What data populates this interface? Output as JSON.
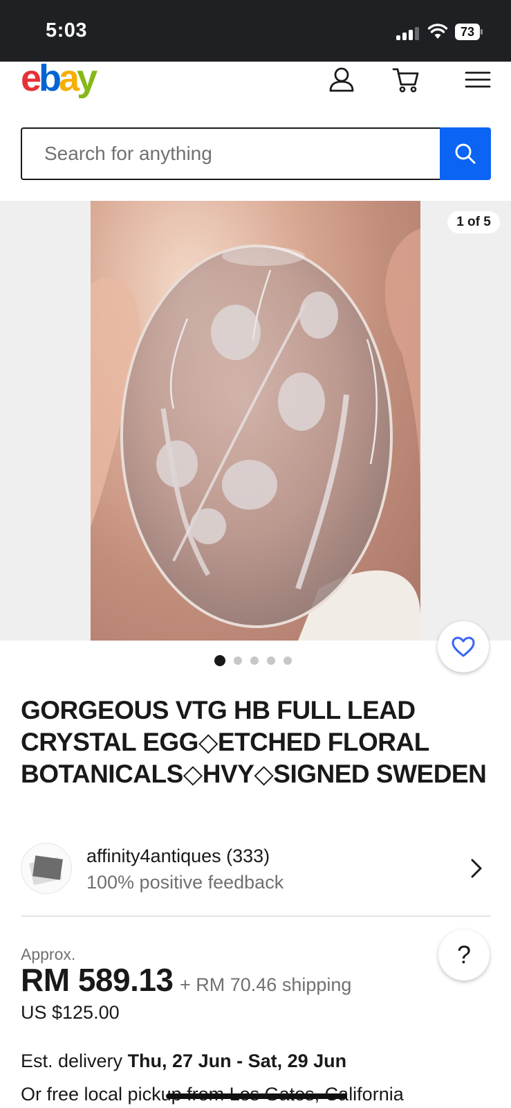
{
  "status_bar": {
    "time": "5:03",
    "battery": "73",
    "icons": [
      "cellular-signal-icon",
      "wifi-icon",
      "battery-icon"
    ]
  },
  "header": {
    "logo": {
      "e": "e",
      "b": "b",
      "a": "a",
      "y": "y"
    },
    "icons": [
      "account-icon",
      "cart-icon",
      "menu-icon"
    ]
  },
  "search": {
    "placeholder": "Search for anything",
    "icon": "search-icon"
  },
  "gallery": {
    "counter": "1 of 5",
    "total_images": 5,
    "active_index": 0,
    "watch_icon": "heart-icon"
  },
  "item": {
    "title": "GORGEOUS VTG HB FULL LEAD CRYSTAL EGG◇ETCHED FLORAL BOTANICALS◇HVY◇SIGNED SWEDEN"
  },
  "seller": {
    "name": "affinity4antiques (333)",
    "feedback": "100% positive feedback"
  },
  "price": {
    "approx_label": "Approx.",
    "amount": "RM 589.13",
    "shipping": "+ RM 70.46 shipping",
    "usd": "US $125.00"
  },
  "delivery": {
    "label": "Est. delivery",
    "dates": "Thu, 27 Jun - Sat, 29 Jun",
    "pickup": "Or free local pickup from Los Gatos, California"
  },
  "help": {
    "label": "?"
  },
  "colors": {
    "ebay_red": "#e53238",
    "ebay_blue": "#0064d2",
    "ebay_yellow": "#f5af02",
    "ebay_green": "#86b817",
    "search_button": "#0b64f4",
    "watch_heart": "#3665f3"
  }
}
